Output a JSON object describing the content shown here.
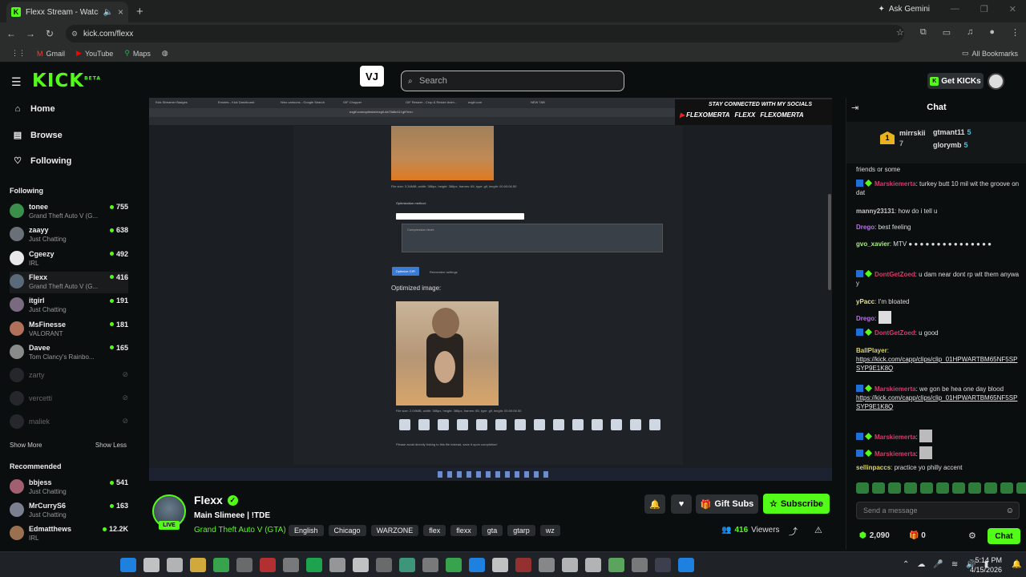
{
  "browser": {
    "tab_title": "Flexx Stream - Watch Live o",
    "url": "kick.com/flexx",
    "ask_gemini": "Ask Gemini",
    "bookmarks": [
      "Gmail",
      "YouTube",
      "Maps"
    ],
    "all_bookmarks": "All Bookmarks"
  },
  "kick": {
    "logo": "KICK",
    "beta": "BETA",
    "vlogo": "VJ",
    "search_placeholder": "Search",
    "get_kicks": "Get KICKs"
  },
  "sidebar": {
    "nav": [
      {
        "label": "Home",
        "icon": "home-icon"
      },
      {
        "label": "Browse",
        "icon": "browse-icon"
      },
      {
        "label": "Following",
        "icon": "heart-icon"
      }
    ],
    "following_header": "Following",
    "following": [
      {
        "name": "tonee",
        "game": "Grand Theft Auto V (G...",
        "viewers": "755",
        "color": "#3a8f4a"
      },
      {
        "name": "zaayy",
        "game": "Just Chatting",
        "viewers": "638",
        "color": "#6a7078"
      },
      {
        "name": "Cgeezy",
        "game": "IRL",
        "viewers": "492",
        "color": "#e8e8e8"
      },
      {
        "name": "Flexx",
        "game": "Grand Theft Auto V (G...",
        "viewers": "416",
        "color": "#5a6a7a"
      },
      {
        "name": "itgirl",
        "game": "Just Chatting",
        "viewers": "191",
        "color": "#7a6a80"
      },
      {
        "name": "MsFinesse",
        "game": "VALORANT",
        "viewers": "181",
        "color": "#b0705a"
      },
      {
        "name": "Davee",
        "game": "Tom Clancy's Rainbo...",
        "viewers": "165",
        "color": "#8a8a8a"
      }
    ],
    "offline": [
      "zarty",
      "vercetti",
      "maliek"
    ],
    "show_more": "Show More",
    "show_less": "Show Less",
    "recommended_header": "Recommended",
    "recommended": [
      {
        "name": "bbjess",
        "game": "Just Chatting",
        "viewers": "541",
        "color": "#a06070"
      },
      {
        "name": "MrCurryS6",
        "game": "Just Chatting",
        "viewers": "163",
        "color": "#7a8090"
      },
      {
        "name": "Edmatthews",
        "game": "IRL",
        "viewers": "12.2K",
        "color": "#9a7050"
      }
    ]
  },
  "video": {
    "mini_tabs": [
      "Kick Streamer Badges",
      "Emotes - Kick Dashboard",
      "Nino cartoons - Google Search",
      "GIF Chopper",
      "GIF Resizer - Crop & Resize Anim...",
      "ezgif.com",
      "NEW TAB"
    ],
    "mini_url": "ezgif.com/optimize/ezgif-4a70d8e11f.gif?err=",
    "banner_top": "STAY CONNECTED WITH MY SOCIALS",
    "socials": [
      "FLEXOMERTA",
      "FLEXX",
      "FLEXOMERTA"
    ],
    "file_meta_1": "File size: 3.34MiB, width: 386px, height: 386px, frames: 65, type: gif, length: 00:00:06.50",
    "opt_method": "Optimization method:",
    "comp_level": "Compression level:",
    "optimize_btn": "Optimize GIF!",
    "remember": "Remember settings",
    "optimized_label": "Optimized image:",
    "file_meta_2": "File size: 2.04MiB, width: 386px, height: 386px, frames: 65, type: gif, length: 00:00:06.50",
    "footnote": "Please avoid directly linking to this file instead, save it upon completion!"
  },
  "channel": {
    "name": "Flexx",
    "live": "LIVE",
    "title": "Main Slimeee | !TDE",
    "category": "Grand Theft Auto V (GTA)",
    "tags": [
      "English",
      "Chicago",
      "WARZONE",
      "flex",
      "flexx",
      "gta",
      "gtarp",
      "wz"
    ],
    "gift_subs": "Gift Subs",
    "subscribe": "Subscribe",
    "viewers": "416",
    "viewers_label": "Viewers"
  },
  "chat": {
    "title": "Chat",
    "leaders": [
      {
        "name": "mirrskii",
        "count": "7"
      },
      {
        "name": "gtmant11",
        "count": "5"
      },
      {
        "name": "glorymb",
        "count": "5"
      }
    ],
    "messages": [
      {
        "text": "friends or some"
      },
      {
        "user": "Marskiemerta",
        "cls": "u-mars",
        "badges": true,
        "text": "turkey butt 10 mil wit the groove on dat"
      },
      {
        "user": "manny23131",
        "cls": "u-manny",
        "text": "how do i tell u"
      },
      {
        "user": "Drego",
        "cls": "u-drego",
        "text": "best feeling"
      },
      {
        "user": "gvo_xavier",
        "cls": "u-gvo",
        "text": "MTV ● ● ● ● ● ● ● ● ● ● ● ● ● ● ●"
      },
      {
        "user": "DontGetZoed",
        "cls": "u-dont",
        "badges": true,
        "text": "u dam near dont rp wit them anyway"
      },
      {
        "user": "yPacc",
        "cls": "u-ypacc",
        "text": "I'm bloated"
      },
      {
        "user": "Drego",
        "cls": "u-drego",
        "text": ""
      },
      {
        "user": "DontGetZoed",
        "cls": "u-dont",
        "badges": true,
        "text": "u good"
      },
      {
        "user": "BallPlayer",
        "cls": "u-ball",
        "text": "",
        "link": "https://kick.com/capp/clips/clip_01HPWARTBM65NF5SPSYP9E1K8Q"
      },
      {
        "user": "Marskiemerta",
        "cls": "u-mars",
        "badges": true,
        "text": "we gon be hea one day blood",
        "link": "https://kick.com/capp/clips/clip_01HPWARTBM65NF5SPSYP9E1K8Q"
      },
      {
        "user": "Marskiemerta",
        "cls": "u-mars",
        "badges": true,
        "text": ""
      },
      {
        "user": "Marskiemerta",
        "cls": "u-mars",
        "badges": true,
        "text": ""
      },
      {
        "user": "sellinpaccs",
        "cls": "u-sell",
        "text": "practice yo philly accent"
      }
    ],
    "input_placeholder": "Send a message",
    "points": "2,090",
    "gifts": "0",
    "chat_btn": "Chat"
  },
  "taskbar": {
    "time": "5:14 PM",
    "date": "4/15/2026"
  }
}
